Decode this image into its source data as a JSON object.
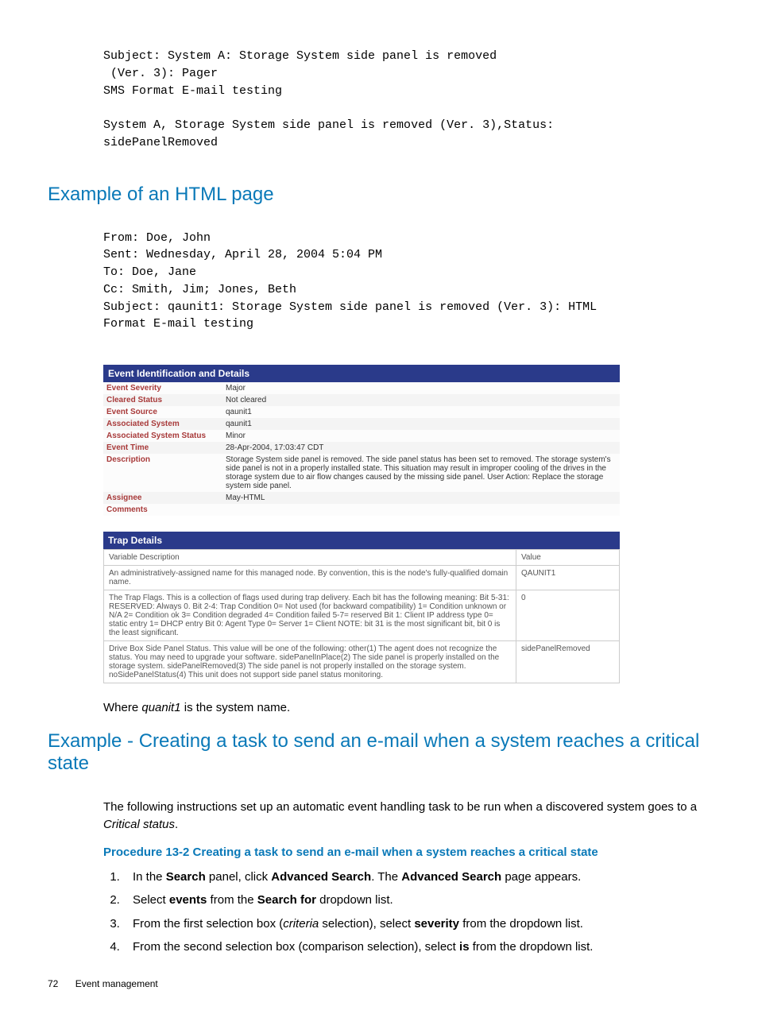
{
  "top_mono": "Subject: System A: Storage System side panel is removed\n (Ver. 3): Pager\nSMS Format E-mail testing\n\nSystem A, Storage System side panel is removed (Ver. 3),Status:\nsidePanelRemoved",
  "h_html_example": "Example of an HTML page",
  "email_mono": "From: Doe, John\nSent: Wednesday, April 28, 2004 5:04 PM\nTo: Doe, Jane\nCc: Smith, Jim; Jones, Beth\nSubject: qaunit1: Storage System side panel is removed (Ver. 3): HTML\nFormat E-mail testing",
  "eid": {
    "title": "Event Identification and Details",
    "rows": [
      {
        "label": "Event Severity",
        "value": "Major"
      },
      {
        "label": "Cleared Status",
        "value": "Not cleared"
      },
      {
        "label": "Event Source",
        "value": "qaunit1"
      },
      {
        "label": "Associated System",
        "value": "qaunit1"
      },
      {
        "label": "Associated System Status",
        "value": "Minor"
      },
      {
        "label": "Event Time",
        "value": "28-Apr-2004, 17:03:47 CDT"
      },
      {
        "label": "Description",
        "value": "Storage System side panel is removed. The side panel status has been set to removed. The storage system's side panel is not in a properly installed state. This situation may result in improper cooling of the drives in the storage system due to air flow changes caused by the missing side panel. User Action: Replace the storage system side panel."
      },
      {
        "label": "Assignee",
        "value": "May-HTML"
      },
      {
        "label": "Comments",
        "value": ""
      }
    ]
  },
  "trap": {
    "title": "Trap Details",
    "head_desc": "Variable Description",
    "head_val": "Value",
    "rows": [
      {
        "desc": "An administratively-assigned name for this managed node. By convention, this is the node's fully-qualified domain name.",
        "val": "QAUNIT1"
      },
      {
        "desc": "The Trap Flags. This is a collection of flags used during trap delivery. Each bit has the following meaning: Bit 5-31: RESERVED: Always 0. Bit 2-4: Trap Condition 0= Not used (for backward compatibility) 1= Condition unknown or N/A 2= Condition ok 3= Condition degraded 4= Condition failed 5-7= reserved Bit 1: Client IP address type 0= static entry 1= DHCP entry Bit 0: Agent Type 0= Server 1= Client NOTE: bit 31 is the most significant bit, bit 0 is the least significant.",
        "val": "0"
      },
      {
        "desc": "Drive Box Side Panel Status. This value will be one of the following: other(1) The agent does not recognize the status. You may need to upgrade your software. sidePanelInPlace(2) The side panel is properly installed on the storage system. sidePanelRemoved(3) The side panel is not properly installed on the storage system. noSidePanelStatus(4) This unit does not support side panel status monitoring.",
        "val": "sidePanelRemoved"
      }
    ]
  },
  "where_note_pre": "Where ",
  "where_note_em": "quanit1",
  "where_note_post": " is the system name.",
  "h_task": "Example - Creating a task to send an e-mail when a system reaches a critical state",
  "intro_1": "The following instructions set up an automatic event handling task to be run when a discovered system goes to a ",
  "intro_em": "Critical status",
  "intro_2": ".",
  "proc_title": "Procedure 13-2 Creating a task to send an e-mail when a system reaches a critical state",
  "steps": {
    "s1a": "In the ",
    "s1b": "Search",
    "s1c": " panel, click ",
    "s1d": "Advanced Search",
    "s1e": ". The ",
    "s1f": "Advanced Search",
    "s1g": " page appears.",
    "s2a": "Select ",
    "s2b": "events",
    "s2c": " from the ",
    "s2d": "Search for",
    "s2e": " dropdown list.",
    "s3a": "From the first selection box (",
    "s3b": "criteria",
    "s3c": " selection), select ",
    "s3d": "severity",
    "s3e": " from the dropdown list.",
    "s4a": "From the second selection box (comparison selection), select ",
    "s4b": "is",
    "s4c": " from the dropdown list."
  },
  "footer_page": "72",
  "footer_label": "Event management"
}
